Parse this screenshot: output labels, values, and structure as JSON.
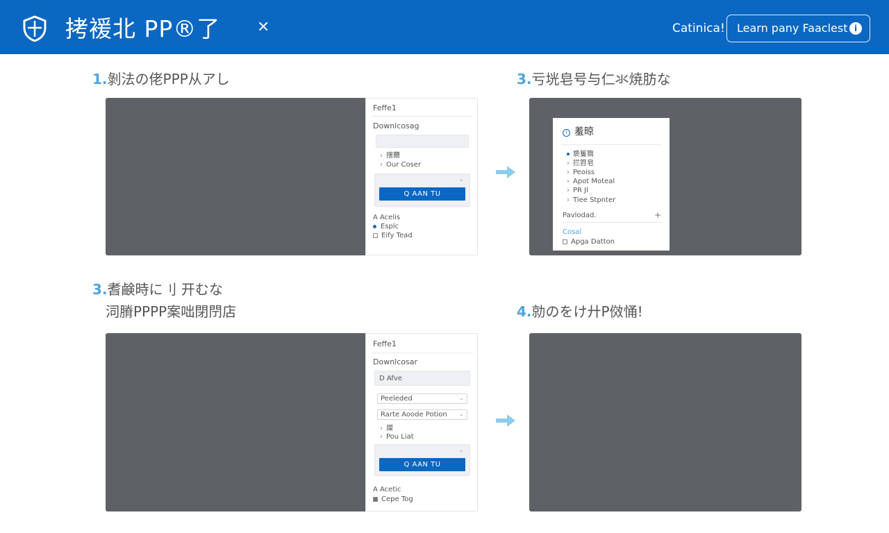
{
  "header": {
    "title": "拷褑北 PP®了",
    "close_icon": "close-icon",
    "link_text": "Catinica!",
    "learn_button": "Learn pany Faaclest",
    "info_icon": "i",
    "bg_color": "#0a67c2"
  },
  "steps": [
    {
      "number": "1.",
      "title": "剝法の佬PPP从アし",
      "panel": {
        "heading": "Feffe1",
        "subheading": "Downlcosag",
        "tree": [
          "搳薾",
          "Our Coser"
        ],
        "button": "Q AAN TU",
        "section": "A Acelis",
        "radio": "Esplc",
        "checkbox": "Eify Tead"
      }
    },
    {
      "number": "3.",
      "title": "亏垙皂号与仁氺焼肪な",
      "panel": {
        "heading": "羞晾",
        "bullets": [
          "亵篗篛",
          "拦笤皂",
          "Peoiss",
          "Apot Moteal",
          "PR JI",
          "Tiee Stpnter"
        ],
        "row_label": "Pavlodad.",
        "row_action": "+",
        "link": "Cosal",
        "checkbox": "Apga Datton"
      }
    },
    {
      "number": "3.",
      "title_line1": "耆鹸時に刂 开むな",
      "title_line2": "泀膌PPPP案咄閉閅店",
      "panel": {
        "heading": "Feffe1",
        "subheading": "Downlcosar",
        "search": "D Afve",
        "select1": "Peeleded",
        "select2": "Rarte Aoode Potion",
        "tree": [
          "燦",
          "Pou Liat"
        ],
        "button": "Q AAN TU",
        "section": "A Acetic",
        "checkbox": "Cepe Tog"
      }
    },
    {
      "number": "4.",
      "title": "勍のをけ廾P傚悀!"
    }
  ],
  "icons": {
    "shield": "shield-icon",
    "arrow": "arrow-right-icon"
  }
}
